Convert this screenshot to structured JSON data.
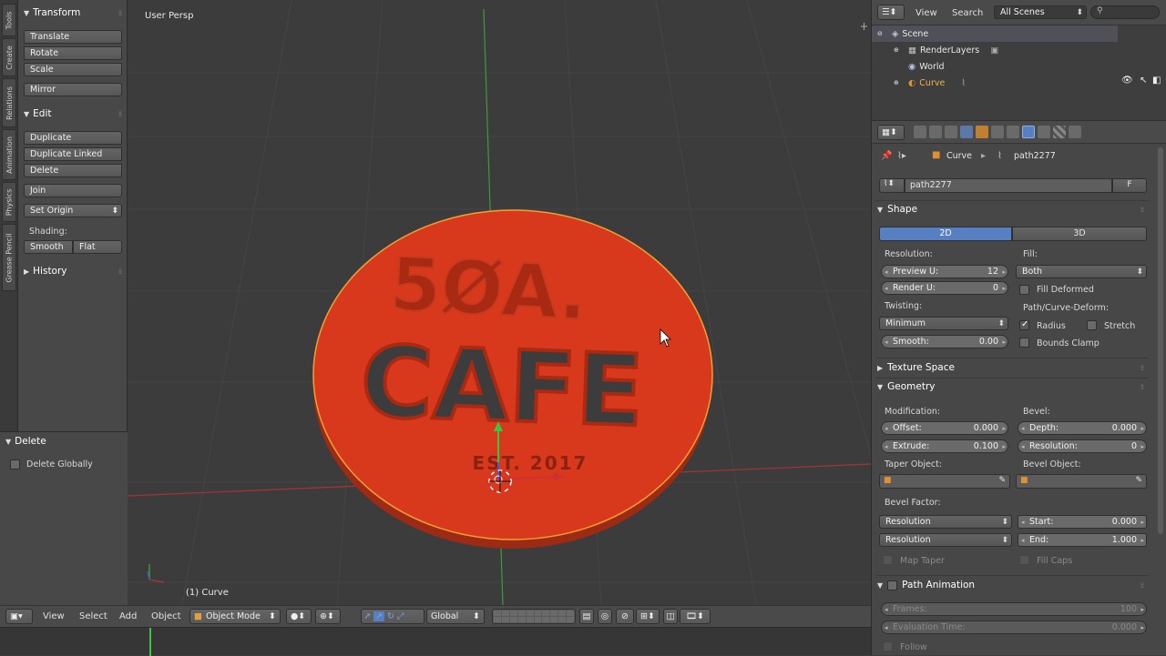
{
  "vertical_tabs": [
    "Tools",
    "Create",
    "Relations",
    "Animation",
    "Physics",
    "Grease Pencil"
  ],
  "toolshelf": {
    "transform": {
      "title": "Transform",
      "buttons": [
        "Translate",
        "Rotate",
        "Scale"
      ],
      "mirror": "Mirror"
    },
    "edit": {
      "title": "Edit",
      "buttons": [
        "Duplicate",
        "Duplicate Linked",
        "Delete"
      ],
      "join": "Join",
      "set_origin": "Set Origin",
      "shading_label": "Shading:",
      "smooth": "Smooth",
      "flat": "Flat"
    },
    "history": {
      "title": "History"
    }
  },
  "redo_panel": {
    "title": "Delete",
    "delete_globally": "Delete Globally",
    "delete_globally_checked": false
  },
  "viewport": {
    "view_name": "User Persp",
    "object_label": "(1) Curve",
    "model_text_top": "5ØA.",
    "model_text_main": "CAFE",
    "model_text_est": "EST. 2017",
    "object_color": "#d8391d"
  },
  "header3d": {
    "menus": [
      "View",
      "Select",
      "Add",
      "Object"
    ],
    "mode": "Object Mode",
    "orientation": "Global"
  },
  "outliner": {
    "header": {
      "view": "View",
      "search": "Search",
      "scene_select": "All Scenes"
    },
    "rows": [
      {
        "label": "Scene",
        "icon": "scene-icon"
      },
      {
        "label": "RenderLayers",
        "icon": "renderlayers-icon"
      },
      {
        "label": "World",
        "icon": "world-icon"
      },
      {
        "label": "Curve",
        "icon": "curve-icon"
      }
    ]
  },
  "properties": {
    "breadcrumb": {
      "object": "Curve",
      "data": "path2277"
    },
    "datablock": {
      "name": "path2277",
      "fake_user": "F"
    },
    "shape": {
      "title": "Shape",
      "tab_2d": "2D",
      "tab_3d": "3D",
      "resolution_label": "Resolution:",
      "preview_u_label": "Preview U:",
      "preview_u": "12",
      "render_u_label": "Render U:",
      "render_u": "0",
      "fill_label": "Fill:",
      "fill_value": "Both",
      "fill_deformed": "Fill Deformed",
      "twisting_label": "Twisting:",
      "twisting_value": "Minimum",
      "smooth_label": "Smooth:",
      "smooth_value": "0.00",
      "path_deform_label": "Path/Curve-Deform:",
      "radius": "Radius",
      "stretch": "Stretch",
      "bounds_clamp": "Bounds Clamp"
    },
    "texture_space": {
      "title": "Texture Space"
    },
    "geometry": {
      "title": "Geometry",
      "modification_label": "Modification:",
      "bevel_label": "Bevel:",
      "offset_label": "Offset:",
      "offset_value": "0.000",
      "depth_label": "Depth:",
      "depth_value": "0.000",
      "extrude_label": "Extrude:",
      "extrude_value": "0.100",
      "bevel_res_label": "Resolution:",
      "bevel_res_value": "0",
      "taper_label": "Taper Object:",
      "bevel_obj_label": "Bevel Object:",
      "bevel_factor_label": "Bevel Factor:",
      "factor_mode_1": "Resolution",
      "factor_mode_2": "Resolution",
      "start_label": "Start:",
      "start_value": "0.000",
      "end_label": "End:",
      "end_value": "1.000",
      "map_taper": "Map Taper",
      "fill_caps": "Fill Caps"
    },
    "path_animation": {
      "title": "Path Animation",
      "frames_label": "Frames:",
      "frames_value": "100",
      "eval_label": "Evaluation Time:",
      "eval_value": "0.000",
      "follow": "Follow"
    }
  },
  "colors": {
    "accent": "#5680c2",
    "object": "#d8391d",
    "outline": "#f0a030"
  }
}
